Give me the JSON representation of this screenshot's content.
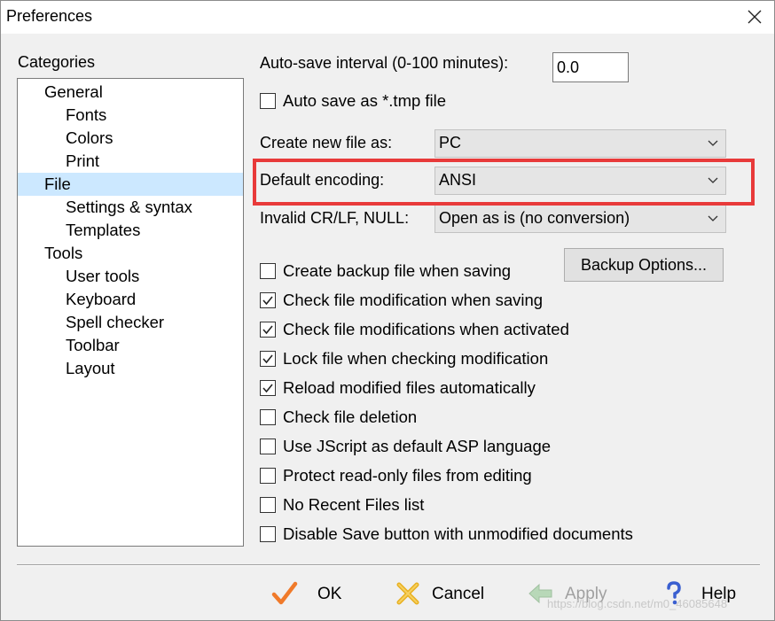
{
  "window": {
    "title": "Preferences"
  },
  "sidebar": {
    "heading": "Categories",
    "items": [
      {
        "label": "General",
        "level": 0,
        "selected": false
      },
      {
        "label": "Fonts",
        "level": 1,
        "selected": false
      },
      {
        "label": "Colors",
        "level": 1,
        "selected": false
      },
      {
        "label": "Print",
        "level": 1,
        "selected": false
      },
      {
        "label": "File",
        "level": 0,
        "selected": true
      },
      {
        "label": "Settings & syntax",
        "level": 1,
        "selected": false
      },
      {
        "label": "Templates",
        "level": 1,
        "selected": false
      },
      {
        "label": "Tools",
        "level": 0,
        "selected": false
      },
      {
        "label": "User tools",
        "level": 1,
        "selected": false
      },
      {
        "label": "Keyboard",
        "level": 1,
        "selected": false
      },
      {
        "label": "Spell checker",
        "level": 1,
        "selected": false
      },
      {
        "label": "Toolbar",
        "level": 1,
        "selected": false
      },
      {
        "label": "Layout",
        "level": 1,
        "selected": false
      }
    ]
  },
  "settings": {
    "autosave_label": "Auto-save interval (0-100 minutes):",
    "autosave_value": "0.0",
    "autosave_tmp": {
      "label": "Auto save as *.tmp file",
      "checked": false
    },
    "create_new_label": "Create new file as:",
    "create_new_value": "PC",
    "encoding_label": "Default encoding:",
    "encoding_value": "ANSI",
    "invalid_label": "Invalid CR/LF, NULL:",
    "invalid_value": "Open as is (no conversion)",
    "backup_button": "Backup Options...",
    "checkboxes": [
      {
        "label": "Create backup file when saving",
        "checked": false
      },
      {
        "label": "Check file modification when saving",
        "checked": true
      },
      {
        "label": "Check file modifications when activated",
        "checked": true
      },
      {
        "label": "Lock file when checking modification",
        "checked": true
      },
      {
        "label": "Reload modified files automatically",
        "checked": true
      },
      {
        "label": "Check file deletion",
        "checked": false
      },
      {
        "label": "Use JScript as default ASP language",
        "checked": false
      },
      {
        "label": "Protect read-only files from editing",
        "checked": false
      },
      {
        "label": "No Recent Files list",
        "checked": false
      },
      {
        "label": "Disable Save button with unmodified documents",
        "checked": false
      }
    ]
  },
  "footer": {
    "ok": "OK",
    "cancel": "Cancel",
    "apply": "Apply",
    "help": "Help",
    "watermark": "https://blog.csdn.net/m0_46085648"
  },
  "colors": {
    "highlight": "#e83a3a",
    "selection": "#cce8ff",
    "check_icon": "#f07a2a",
    "cancel_icon": "#e8b020",
    "help_icon": "#3a5fd0"
  },
  "icons": {
    "close": "close-icon",
    "check": "checkmark-icon",
    "ok": "ok-checkmark-icon",
    "cancel": "cancel-x-icon",
    "apply": "apply-arrow-icon",
    "help": "help-question-icon",
    "dropdown": "chevron-down-icon"
  }
}
